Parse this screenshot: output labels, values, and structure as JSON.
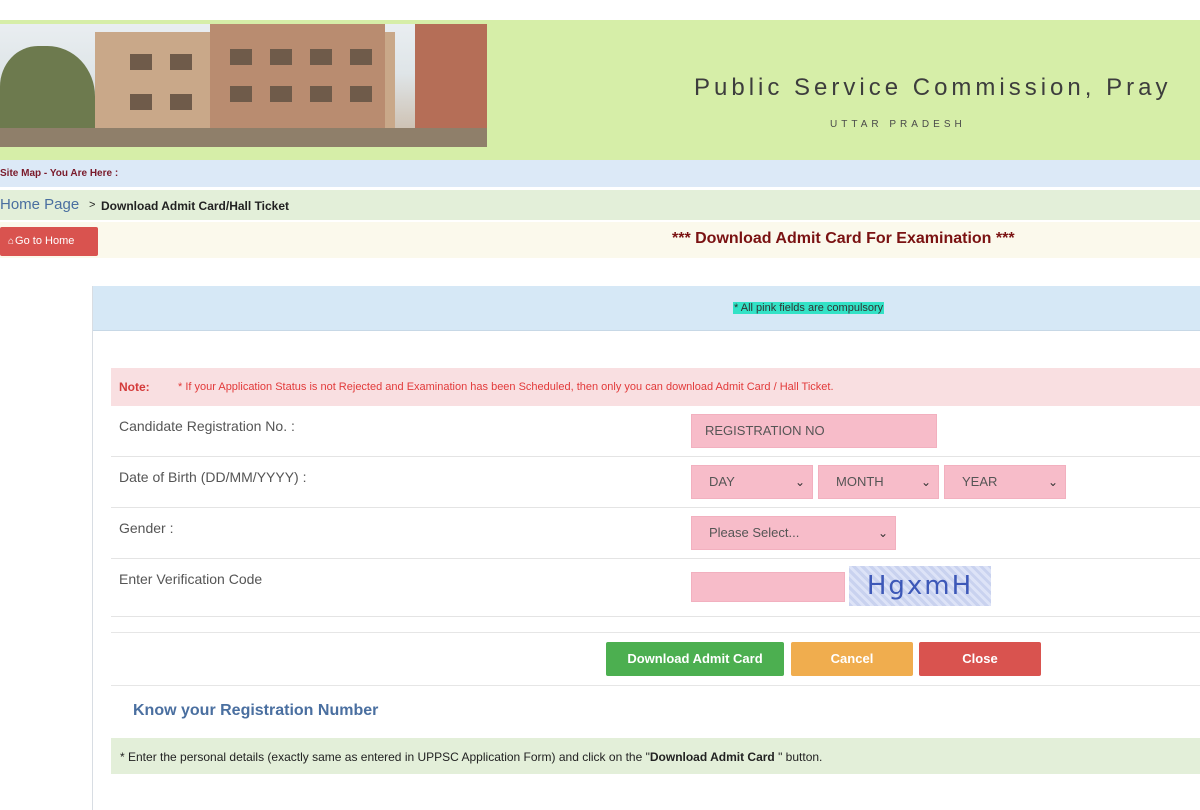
{
  "banner": {
    "title": "Public Service Commission, Pray",
    "subtitle": "UTTAR PRADESH"
  },
  "sitemap": {
    "label": "Site Map - You Are Here :"
  },
  "breadcrumb": {
    "home": "Home Page",
    "separator": ">",
    "current": "Download Admit Card/Hall Ticket"
  },
  "header": {
    "home_button": "Go to Home",
    "home_icon": "home-icon",
    "title": "*** Download Admit Card For Examination ***"
  },
  "form": {
    "compulsory_note": "* All pink fields are compulsory",
    "note_label": "Note:",
    "note_text": "* If your Application Status is not Rejected and Examination has been Scheduled, then only you can download Admit Card / Hall Ticket.",
    "fields": {
      "registration": {
        "label": "Candidate Registration No. :",
        "placeholder": "REGISTRATION NO"
      },
      "dob": {
        "label": "Date of Birth (DD/MM/YYYY) :",
        "day": "DAY",
        "month": "MONTH",
        "year": "YEAR"
      },
      "gender": {
        "label": "Gender :",
        "selected": "Please Select..."
      },
      "verification": {
        "label": "Enter Verification Code",
        "captcha": "HgxmH"
      }
    },
    "buttons": {
      "download": "Download Admit Card",
      "cancel": "Cancel",
      "close": "Close"
    },
    "know_registration": "Know your Registration Number",
    "footer_note": {
      "before": "* Enter the personal details (exactly same as entered in UPPSC Application Form) and click on the \"",
      "bold": "Download Admit Card",
      "after": " \" button."
    }
  },
  "colors": {
    "banner_bg": "#d6eea8",
    "pink_field": "#f7bcc9",
    "title_red": "#7a1212",
    "success": "#4caf50",
    "warning": "#f0ad4e",
    "danger": "#d9534f"
  }
}
